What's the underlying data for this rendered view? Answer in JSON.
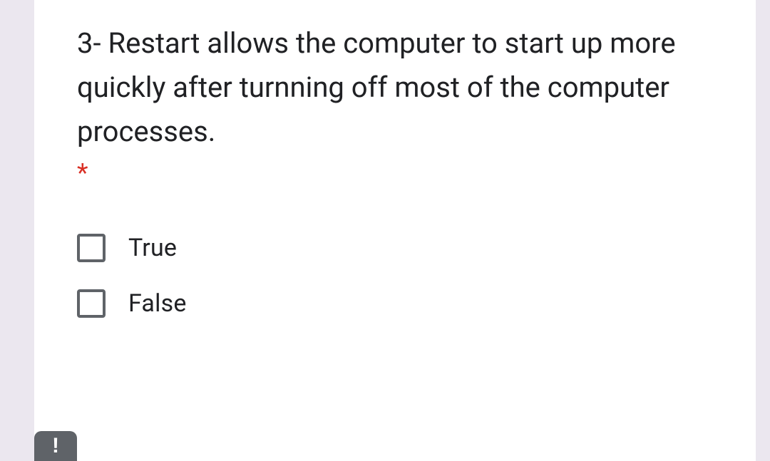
{
  "question": {
    "text": "3- Restart allows the computer to start up more quickly after turnning off most of the computer processes.",
    "required_marker": "*",
    "options": [
      {
        "label": "True"
      },
      {
        "label": "False"
      }
    ]
  },
  "feedback": {
    "icon_text": "!"
  }
}
